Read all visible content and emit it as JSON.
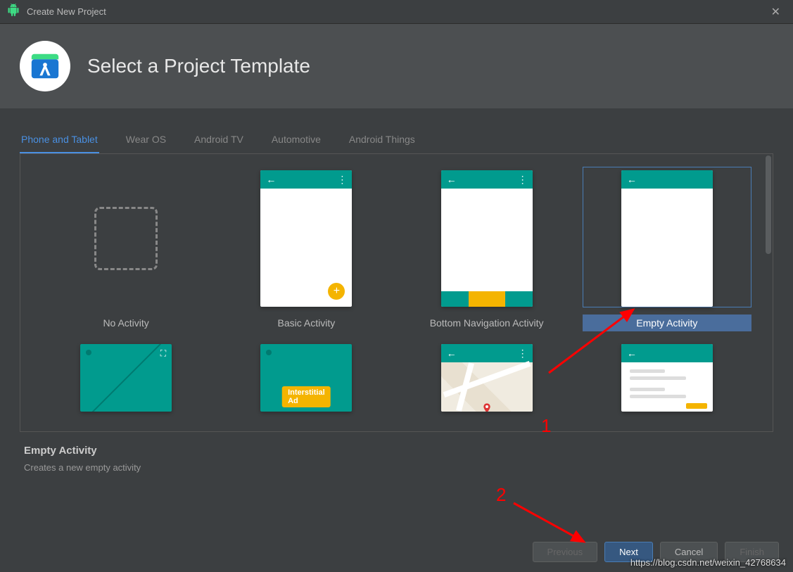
{
  "window": {
    "title": "Create New Project"
  },
  "header": {
    "heading": "Select a Project Template"
  },
  "tabs": [
    {
      "label": "Phone and Tablet",
      "active": true
    },
    {
      "label": "Wear OS",
      "active": false
    },
    {
      "label": "Android TV",
      "active": false
    },
    {
      "label": "Automotive",
      "active": false
    },
    {
      "label": "Android Things",
      "active": false
    }
  ],
  "templates_row1": [
    {
      "label": "No Activity",
      "kind": "none"
    },
    {
      "label": "Basic Activity",
      "kind": "basic"
    },
    {
      "label": "Bottom Navigation Activity",
      "kind": "bottomnav"
    },
    {
      "label": "Empty Activity",
      "kind": "empty",
      "selected": true
    }
  ],
  "templates_row2": [
    {
      "kind": "fullscreen"
    },
    {
      "kind": "ad",
      "ad_text": "Interstitial Ad"
    },
    {
      "kind": "map"
    },
    {
      "kind": "list"
    }
  ],
  "footer": {
    "title": "Empty Activity",
    "description": "Creates a new empty activity"
  },
  "buttons": {
    "previous": "Previous",
    "next": "Next",
    "cancel": "Cancel",
    "finish": "Finish"
  },
  "annotations": {
    "label1": "1",
    "label2": "2"
  },
  "watermark": "https://blog.csdn.net/weixin_42768634"
}
